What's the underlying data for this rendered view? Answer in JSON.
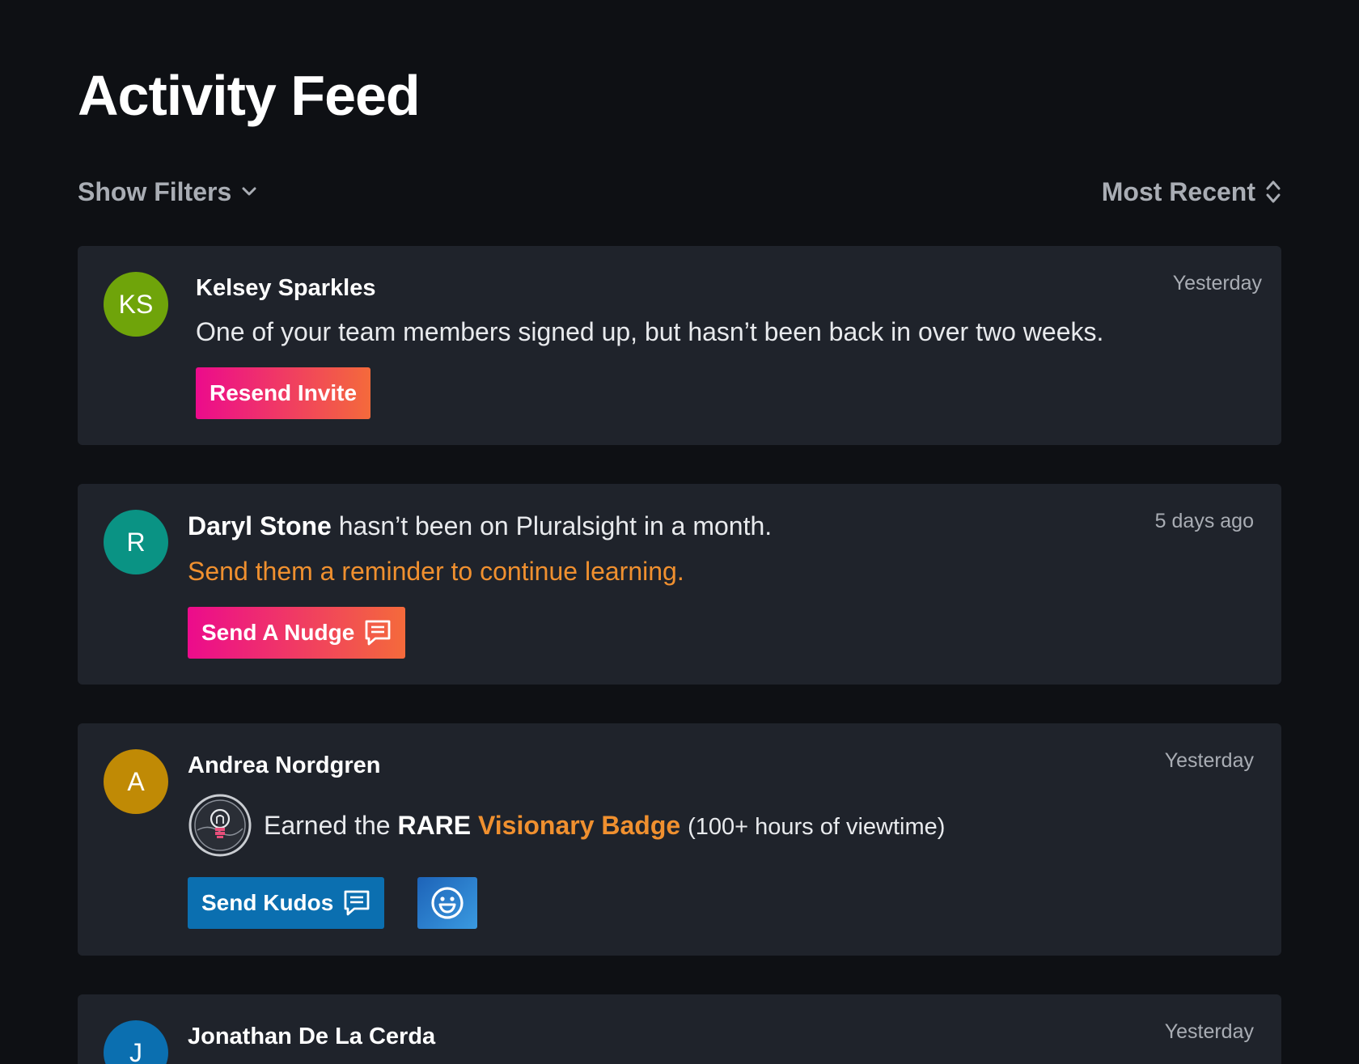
{
  "page": {
    "title": "Activity Feed"
  },
  "toolbar": {
    "filters_label": "Show Filters",
    "sort_label": "Most Recent"
  },
  "colors": {
    "background": "#0e1014",
    "card": "#1f232b",
    "accent_orange": "#f0902f",
    "gradient_start": "#ec0b8c",
    "gradient_end": "#f46a3b",
    "kudos_blue": "#0b6fb0"
  },
  "feed": [
    {
      "avatar_initials": "KS",
      "avatar_color": "#6fa40a",
      "name": "Kelsey Sparkles",
      "timestamp": "Yesterday",
      "message": "One of your team members signed up, but hasn’t been back in over two weeks.",
      "action_label": "Resend Invite"
    },
    {
      "avatar_initials": "R",
      "avatar_color": "#0a9384",
      "name": "Daryl Stone",
      "message_suffix": " hasn’t been on Pluralsight in a month.",
      "timestamp": "5 days ago",
      "hint": "Send them a reminder to continue learning.",
      "action_label": "Send A Nudge",
      "action_icon": "chat-icon"
    },
    {
      "avatar_initials": "A",
      "avatar_color": "#c08a05",
      "name": "Andrea Nordgren",
      "timestamp": "Yesterday",
      "badge_icon": "lightbulb-badge-icon",
      "badge_prefix": "Earned the ",
      "badge_rarity": "RARE",
      "badge_name": "Visionary Badge",
      "badge_detail": "(100+ hours of viewtime)",
      "action_label": "Send Kudos",
      "action_icon": "chat-icon",
      "emoji_icon": "smiley-icon"
    },
    {
      "avatar_initials": "J",
      "avatar_color": "#0b6fb0",
      "name": "Jonathan De La Cerda",
      "timestamp": "Yesterday"
    }
  ]
}
